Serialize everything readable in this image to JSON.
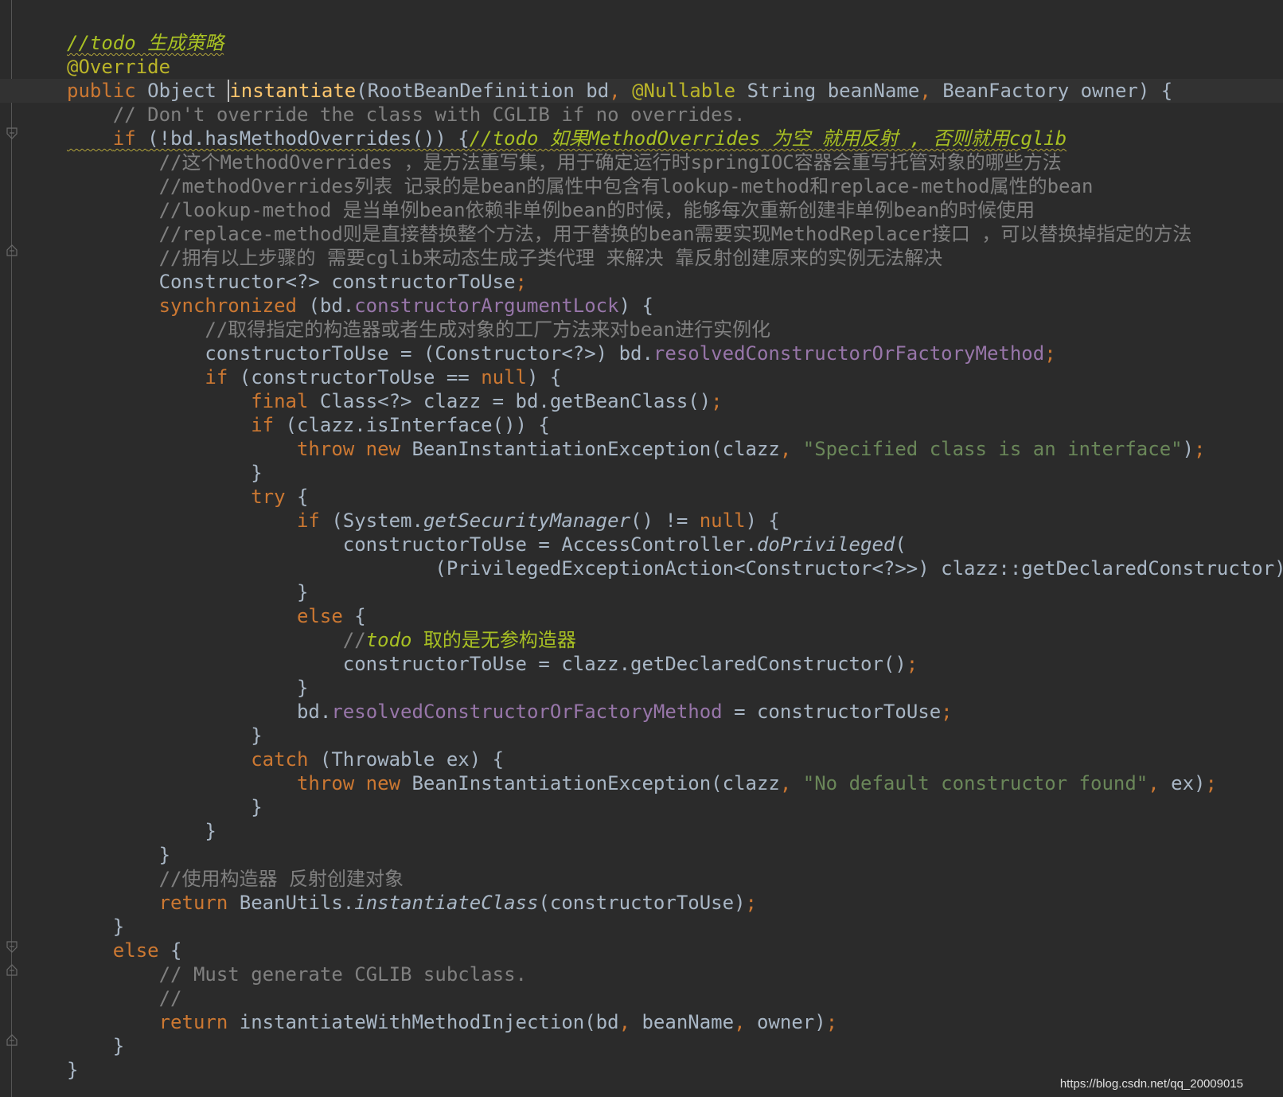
{
  "editor": {
    "lines": [
      [
        {
          "t": "//",
          "c": "todo"
        },
        {
          "t": "todo 生成策略",
          "c": "todo"
        }
      ],
      [
        {
          "t": "@Override",
          "c": "ann"
        }
      ],
      [
        {
          "t": "public ",
          "c": "kw"
        },
        {
          "t": "Object ",
          "c": ""
        },
        {
          "t": "instantiate",
          "c": "fn caret"
        },
        {
          "t": "(RootBeanDefinition bd",
          "c": ""
        },
        {
          "t": ", ",
          "c": "kw"
        },
        {
          "t": "@Nullable ",
          "c": "ann"
        },
        {
          "t": "String beanName",
          "c": ""
        },
        {
          "t": ", ",
          "c": "kw"
        },
        {
          "t": "BeanFactory owner) {",
          "c": ""
        }
      ],
      [
        {
          "t": "    // Don't override the class with CGLIB if no overrides.",
          "c": "cm"
        }
      ],
      [
        {
          "t": "    ",
          "c": ""
        },
        {
          "t": "if ",
          "c": "kw"
        },
        {
          "t": "(!bd.hasMethodOverrides()) {",
          "c": ""
        },
        {
          "t": "//todo 如果",
          "c": "todo"
        },
        {
          "t": "MethodOverrides",
          "c": "todo"
        },
        {
          "t": " 为空 就用反射 , 否则就用",
          "c": "todo"
        },
        {
          "t": "cglib",
          "c": "todo"
        }
      ],
      [
        {
          "t": "        //这个MethodOverrides ，是方法重写集，用于确定运行时springIOC容器会重写托管对象的哪些方法",
          "c": "cm"
        }
      ],
      [
        {
          "t": "        //methodOverrides列表 记录的是bean的属性中包含有lookup-method和replace-method属性的bean",
          "c": "cm"
        }
      ],
      [
        {
          "t": "        //lookup-method 是当单例bean依赖非单例bean的时候，能够每次重新创建非单例bean的时候使用",
          "c": "cm"
        }
      ],
      [
        {
          "t": "        //replace-method则是直接替换整个方法，用于替换的bean需要实现MethodReplacer接口 ，可以替换掉指定的方法",
          "c": "cm"
        }
      ],
      [
        {
          "t": "        //拥有以上步骤的 需要cglib来动态生成子类代理 来解决 靠反射创建原来的实例无法解决",
          "c": "cm"
        }
      ],
      [
        {
          "t": "        Constructor<?> constructorToUse",
          "c": ""
        },
        {
          "t": ";",
          "c": "kw"
        }
      ],
      [
        {
          "t": "        ",
          "c": ""
        },
        {
          "t": "synchronized ",
          "c": "kw"
        },
        {
          "t": "(bd.",
          "c": ""
        },
        {
          "t": "constructorArgumentLock",
          "c": "fld"
        },
        {
          "t": ") {",
          "c": ""
        }
      ],
      [
        {
          "t": "            //取得指定的构造器或者生成对象的工厂方法来对bean进行实例化",
          "c": "cm"
        }
      ],
      [
        {
          "t": "            constructorToUse = (Constructor<?>) bd.",
          "c": ""
        },
        {
          "t": "resolvedConstructorOrFactoryMethod",
          "c": "fld"
        },
        {
          "t": ";",
          "c": "kw"
        }
      ],
      [
        {
          "t": "            ",
          "c": ""
        },
        {
          "t": "if ",
          "c": "kw"
        },
        {
          "t": "(constructorToUse == ",
          "c": ""
        },
        {
          "t": "null",
          "c": "kw"
        },
        {
          "t": ") {",
          "c": ""
        }
      ],
      [
        {
          "t": "                ",
          "c": ""
        },
        {
          "t": "final ",
          "c": "kw"
        },
        {
          "t": "Class<?> clazz = bd.getBeanClass()",
          "c": ""
        },
        {
          "t": ";",
          "c": "kw"
        }
      ],
      [
        {
          "t": "                ",
          "c": ""
        },
        {
          "t": "if ",
          "c": "kw"
        },
        {
          "t": "(clazz.isInterface()) {",
          "c": ""
        }
      ],
      [
        {
          "t": "                    ",
          "c": ""
        },
        {
          "t": "throw new ",
          "c": "kw"
        },
        {
          "t": "BeanInstantiationException(clazz",
          "c": ""
        },
        {
          "t": ", ",
          "c": "kw"
        },
        {
          "t": "\"Specified class is an interface\"",
          "c": "str"
        },
        {
          "t": ")",
          "c": ""
        },
        {
          "t": ";",
          "c": "kw"
        }
      ],
      [
        {
          "t": "                }",
          "c": ""
        }
      ],
      [
        {
          "t": "                ",
          "c": ""
        },
        {
          "t": "try ",
          "c": "kw"
        },
        {
          "t": "{",
          "c": ""
        }
      ],
      [
        {
          "t": "                    ",
          "c": ""
        },
        {
          "t": "if ",
          "c": "kw"
        },
        {
          "t": "(System.",
          "c": ""
        },
        {
          "t": "getSecurityManager",
          "c": "it"
        },
        {
          "t": "() != ",
          "c": ""
        },
        {
          "t": "null",
          "c": "kw"
        },
        {
          "t": ") {",
          "c": ""
        }
      ],
      [
        {
          "t": "                        constructorToUse = AccessController.",
          "c": ""
        },
        {
          "t": "doPrivileged",
          "c": "it"
        },
        {
          "t": "(",
          "c": ""
        }
      ],
      [
        {
          "t": "                                (PrivilegedExceptionAction<Constructor<?>>) clazz::getDeclaredConstructor)",
          "c": ""
        },
        {
          "t": ";",
          "c": "kw"
        }
      ],
      [
        {
          "t": "                    }",
          "c": ""
        }
      ],
      [
        {
          "t": "                    ",
          "c": ""
        },
        {
          "t": "else ",
          "c": "kw"
        },
        {
          "t": "{",
          "c": ""
        }
      ],
      [
        {
          "t": "                        //",
          "c": "cm"
        },
        {
          "t": "todo ",
          "c": "todo"
        },
        {
          "t": "取的是无参构造器",
          "c": "todo-plain"
        }
      ],
      [
        {
          "t": "                        constructorToUse = clazz.getDeclaredConstructor()",
          "c": ""
        },
        {
          "t": ";",
          "c": "kw"
        }
      ],
      [
        {
          "t": "                    }",
          "c": ""
        }
      ],
      [
        {
          "t": "                    bd.",
          "c": ""
        },
        {
          "t": "resolvedConstructorOrFactoryMethod",
          "c": "fld"
        },
        {
          "t": " = constructorToUse",
          "c": ""
        },
        {
          "t": ";",
          "c": "kw"
        }
      ],
      [
        {
          "t": "                }",
          "c": ""
        }
      ],
      [
        {
          "t": "                ",
          "c": ""
        },
        {
          "t": "catch ",
          "c": "kw"
        },
        {
          "t": "(Throwable ex) {",
          "c": ""
        }
      ],
      [
        {
          "t": "                    ",
          "c": ""
        },
        {
          "t": "throw new ",
          "c": "kw"
        },
        {
          "t": "BeanInstantiationException(clazz",
          "c": ""
        },
        {
          "t": ", ",
          "c": "kw"
        },
        {
          "t": "\"No default constructor found\"",
          "c": "str"
        },
        {
          "t": ", ",
          "c": "kw"
        },
        {
          "t": "ex)",
          "c": ""
        },
        {
          "t": ";",
          "c": "kw"
        }
      ],
      [
        {
          "t": "                }",
          "c": ""
        }
      ],
      [
        {
          "t": "            }",
          "c": ""
        }
      ],
      [
        {
          "t": "        }",
          "c": ""
        }
      ],
      [
        {
          "t": "        //使用构造器 反射创建对象",
          "c": "cm"
        }
      ],
      [
        {
          "t": "        ",
          "c": ""
        },
        {
          "t": "return ",
          "c": "kw"
        },
        {
          "t": "BeanUtils.",
          "c": ""
        },
        {
          "t": "instantiateClass",
          "c": "it"
        },
        {
          "t": "(constructorToUse)",
          "c": ""
        },
        {
          "t": ";",
          "c": "kw"
        }
      ],
      [
        {
          "t": "    }",
          "c": ""
        }
      ],
      [
        {
          "t": "    ",
          "c": ""
        },
        {
          "t": "else ",
          "c": "kw"
        },
        {
          "t": "{",
          "c": ""
        }
      ],
      [
        {
          "t": "        // Must generate CGLIB subclass.",
          "c": "cm"
        }
      ],
      [
        {
          "t": "        //",
          "c": "cm"
        }
      ],
      [
        {
          "t": "        ",
          "c": ""
        },
        {
          "t": "return ",
          "c": "kw"
        },
        {
          "t": "instantiateWithMethodInjection(bd",
          "c": ""
        },
        {
          "t": ", ",
          "c": "kw"
        },
        {
          "t": "beanName",
          "c": ""
        },
        {
          "t": ", ",
          "c": "kw"
        },
        {
          "t": "owner)",
          "c": ""
        },
        {
          "t": ";",
          "c": "kw"
        }
      ],
      [
        {
          "t": "    }",
          "c": ""
        }
      ],
      [
        {
          "t": "}",
          "c": ""
        }
      ]
    ]
  },
  "watermark": "https://blog.csdn.net/qq_20009015",
  "colors": {
    "background": "#2b2b2b",
    "text": "#a9b7c6",
    "keyword": "#cc7832",
    "comment": "#808080",
    "todo": "#a8c023",
    "annotation": "#bbb529",
    "method_decl": "#ffc66d",
    "field": "#9876aa",
    "string": "#6a8759"
  },
  "icons": [
    "fold-marker-icon"
  ]
}
